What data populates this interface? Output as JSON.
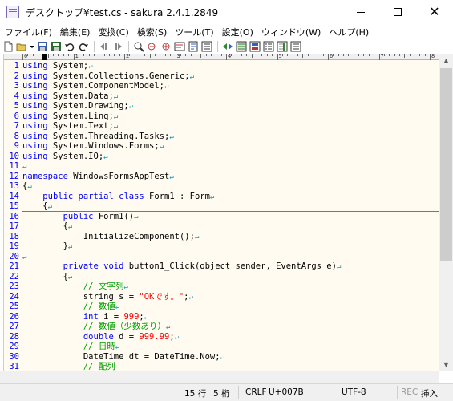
{
  "window": {
    "title": "デスクトップ¥test.cs - sakura 2.4.1.2849",
    "minimize": "—",
    "maximize": "□",
    "close": "✕"
  },
  "menu": [
    "ファイル(F)",
    "編集(E)",
    "変換(C)",
    "検索(S)",
    "ツール(T)",
    "設定(O)",
    "ウィンドウ(W)",
    "ヘルプ(H)"
  ],
  "toolbar": {
    "icons": [
      "new-file-icon",
      "open-file-icon",
      "dropdown-icon",
      "save-icon",
      "save-all-icon",
      "undo-icon",
      "redo-icon",
      "jump-back-icon",
      "jump-forward-icon",
      "find-icon",
      "find-prev-icon",
      "find-next-icon",
      "replace-icon",
      "bookmark-icon",
      "grep-icon",
      "outline-icon",
      "tag-jump-icon",
      "compare-icon",
      "property-icon",
      "function-list-icon",
      "settings-icon",
      "font-icon"
    ]
  },
  "ruler": {
    "labels": [
      "0",
      "1",
      "2",
      "3",
      "4",
      "5",
      "6",
      "7",
      "8"
    ]
  },
  "editor": {
    "lines": [
      {
        "n": "1",
        "parts": [
          {
            "t": "using",
            "c": "kw"
          },
          {
            "t": " System;",
            "c": ""
          }
        ]
      },
      {
        "n": "2",
        "parts": [
          {
            "t": "using",
            "c": "kw"
          },
          {
            "t": " System.Collections.Generic;",
            "c": ""
          }
        ]
      },
      {
        "n": "3",
        "parts": [
          {
            "t": "using",
            "c": "kw"
          },
          {
            "t": " System.ComponentModel;",
            "c": ""
          }
        ]
      },
      {
        "n": "4",
        "parts": [
          {
            "t": "using",
            "c": "kw"
          },
          {
            "t": " System.Data;",
            "c": ""
          }
        ]
      },
      {
        "n": "5",
        "parts": [
          {
            "t": "using",
            "c": "kw"
          },
          {
            "t": " System.Drawing;",
            "c": ""
          }
        ]
      },
      {
        "n": "6",
        "parts": [
          {
            "t": "using",
            "c": "kw"
          },
          {
            "t": " System.Linq;",
            "c": ""
          }
        ]
      },
      {
        "n": "7",
        "parts": [
          {
            "t": "using",
            "c": "kw"
          },
          {
            "t": " System.Text;",
            "c": ""
          }
        ]
      },
      {
        "n": "8",
        "parts": [
          {
            "t": "using",
            "c": "kw"
          },
          {
            "t": " System.Threading.Tasks;",
            "c": ""
          }
        ]
      },
      {
        "n": "9",
        "parts": [
          {
            "t": "using",
            "c": "kw"
          },
          {
            "t": " System.Windows.Forms;",
            "c": ""
          }
        ]
      },
      {
        "n": "10",
        "parts": [
          {
            "t": "using",
            "c": "kw"
          },
          {
            "t": " System.IO;",
            "c": ""
          }
        ]
      },
      {
        "n": "11",
        "parts": []
      },
      {
        "n": "12",
        "parts": [
          {
            "t": "namespace",
            "c": "kw"
          },
          {
            "t": " WindowsFormsAppTest",
            "c": ""
          }
        ]
      },
      {
        "n": "13",
        "parts": [
          {
            "t": "{",
            "c": ""
          }
        ]
      },
      {
        "n": "14",
        "parts": [
          {
            "t": "    ",
            "c": ""
          },
          {
            "t": "public partial class",
            "c": "kw"
          },
          {
            "t": " Form1 : Form",
            "c": ""
          }
        ]
      },
      {
        "n": "15",
        "parts": [
          {
            "t": "    {",
            "c": ""
          }
        ]
      },
      {
        "n": "16",
        "parts": [
          {
            "t": "        ",
            "c": ""
          },
          {
            "t": "public",
            "c": "kw"
          },
          {
            "t": " Form1()",
            "c": ""
          }
        ]
      },
      {
        "n": "17",
        "parts": [
          {
            "t": "        {",
            "c": ""
          }
        ]
      },
      {
        "n": "18",
        "parts": [
          {
            "t": "            InitializeComponent();",
            "c": ""
          }
        ]
      },
      {
        "n": "19",
        "parts": [
          {
            "t": "        }",
            "c": ""
          }
        ]
      },
      {
        "n": "20",
        "parts": []
      },
      {
        "n": "21",
        "parts": [
          {
            "t": "        ",
            "c": ""
          },
          {
            "t": "private void",
            "c": "kw"
          },
          {
            "t": " button1_Click(object sender, EventArgs e)",
            "c": ""
          }
        ]
      },
      {
        "n": "22",
        "parts": [
          {
            "t": "        {",
            "c": ""
          }
        ]
      },
      {
        "n": "23",
        "parts": [
          {
            "t": "            ",
            "c": ""
          },
          {
            "t": "// 文字列",
            "c": "cm"
          }
        ]
      },
      {
        "n": "24",
        "parts": [
          {
            "t": "            string s = ",
            "c": ""
          },
          {
            "t": "\"OKです。\"",
            "c": "st"
          },
          {
            "t": ";",
            "c": ""
          }
        ]
      },
      {
        "n": "25",
        "parts": [
          {
            "t": "            ",
            "c": ""
          },
          {
            "t": "// 数値",
            "c": "cm"
          }
        ]
      },
      {
        "n": "26",
        "parts": [
          {
            "t": "            ",
            "c": ""
          },
          {
            "t": "int",
            "c": "kw"
          },
          {
            "t": " i = ",
            "c": ""
          },
          {
            "t": "999",
            "c": "nm"
          },
          {
            "t": ";",
            "c": ""
          }
        ]
      },
      {
        "n": "27",
        "parts": [
          {
            "t": "            ",
            "c": ""
          },
          {
            "t": "// 数値（少数あり）",
            "c": "cm"
          }
        ]
      },
      {
        "n": "28",
        "parts": [
          {
            "t": "            ",
            "c": ""
          },
          {
            "t": "double",
            "c": "kw"
          },
          {
            "t": " d = ",
            "c": ""
          },
          {
            "t": "999.99",
            "c": "nm"
          },
          {
            "t": ";",
            "c": ""
          }
        ]
      },
      {
        "n": "29",
        "parts": [
          {
            "t": "            ",
            "c": ""
          },
          {
            "t": "// 日時",
            "c": "cm"
          }
        ]
      },
      {
        "n": "30",
        "parts": [
          {
            "t": "            DateTime dt = DateTime.Now;",
            "c": ""
          }
        ]
      },
      {
        "n": "31",
        "parts": [
          {
            "t": "            ",
            "c": ""
          },
          {
            "t": "// 配列",
            "c": "cm"
          }
        ]
      }
    ],
    "eol_mark": "↵"
  },
  "status": {
    "line": "15 行",
    "column": "5 桁",
    "newline": "CRLF",
    "char_code": "U+007B",
    "encoding": "UTF-8",
    "rec": "REC",
    "mode": "挿入"
  },
  "colors": {
    "editor_bg": "#fffbf0",
    "keyword": "#0000ff",
    "comment": "#00a000",
    "string": "#ff0000",
    "line_number": "#0000ff"
  }
}
